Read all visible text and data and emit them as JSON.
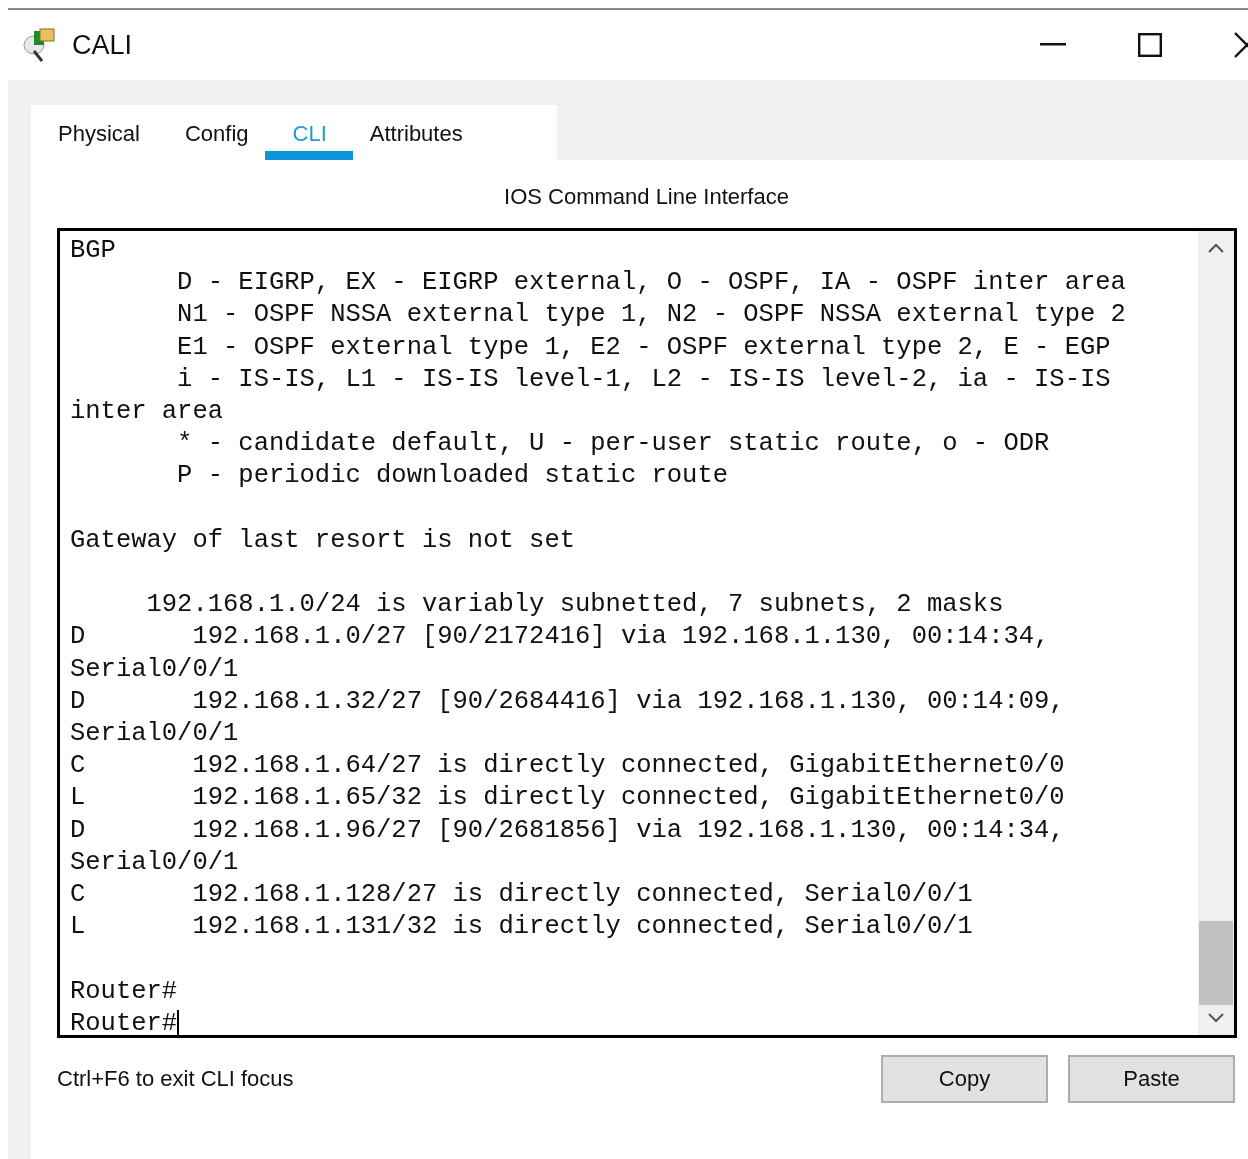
{
  "window": {
    "title": "CALI"
  },
  "tabs": [
    {
      "label": "Physical",
      "selected": false
    },
    {
      "label": "Config",
      "selected": false
    },
    {
      "label": "CLI",
      "selected": true
    },
    {
      "label": "Attributes",
      "selected": false
    }
  ],
  "cli": {
    "heading": "IOS Command Line Interface",
    "blocks": [
      [
        "BGP",
        "       D - EIGRP, EX - EIGRP external, O - OSPF, IA - OSPF inter area",
        "       N1 - OSPF NSSA external type 1, N2 - OSPF NSSA external type 2",
        "       E1 - OSPF external type 1, E2 - OSPF external type 2, E - EGP",
        "       i - IS-IS, L1 - IS-IS level-1, L2 - IS-IS level-2, ia - IS-IS",
        "inter area",
        "       * - candidate default, U - per-user static route, o - ODR",
        "       P - periodic downloaded static route"
      ],
      [
        "Gateway of last resort is not set"
      ],
      [
        "     192.168.1.0/24 is variably subnetted, 7 subnets, 2 masks",
        "D       192.168.1.0/27 [90/2172416] via 192.168.1.130, 00:14:34,",
        "Serial0/0/1",
        "D       192.168.1.32/27 [90/2684416] via 192.168.1.130, 00:14:09,",
        "Serial0/0/1",
        "C       192.168.1.64/27 is directly connected, GigabitEthernet0/0",
        "L       192.168.1.65/32 is directly connected, GigabitEthernet0/0",
        "D       192.168.1.96/27 [90/2681856] via 192.168.1.130, 00:14:34,",
        "Serial0/0/1",
        "C       192.168.1.128/27 is directly connected, Serial0/0/1",
        "L       192.168.1.131/32 is directly connected, Serial0/0/1"
      ],
      [
        "Router#",
        "Router#"
      ]
    ]
  },
  "footer": {
    "hint": "Ctrl+F6 to exit CLI focus"
  },
  "buttons": [
    "Copy",
    "Paste"
  ]
}
